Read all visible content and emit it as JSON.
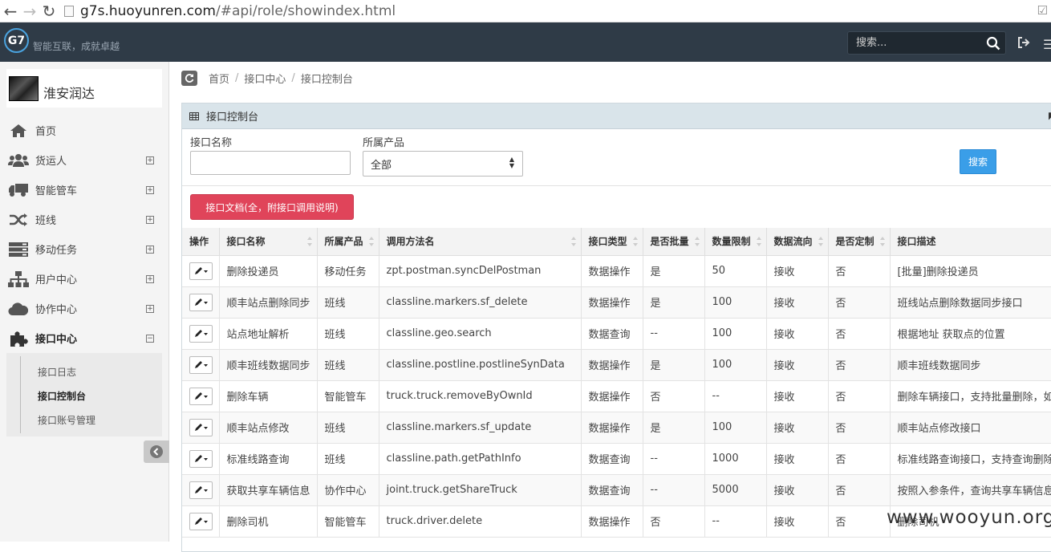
{
  "browser": {
    "url_host": "g7s.huoyunren.com",
    "url_path": "/#api/role/showindex.html"
  },
  "header": {
    "logo_text": "G7",
    "slogan": "智能互联，成就卓越",
    "search_placeholder": "搜索..."
  },
  "sidebar": {
    "org_name": "淮安润达",
    "items": [
      {
        "label": "首页",
        "icon": "home-icon",
        "toggle": ""
      },
      {
        "label": "货运人",
        "icon": "users-icon",
        "toggle": "+"
      },
      {
        "label": "智能管车",
        "icon": "truck-icon",
        "toggle": "+"
      },
      {
        "label": "班线",
        "icon": "random-icon",
        "toggle": "+"
      },
      {
        "label": "移动任务",
        "icon": "server-icon",
        "toggle": "+"
      },
      {
        "label": "用户中心",
        "icon": "sitemap-icon",
        "toggle": "+"
      },
      {
        "label": "协作中心",
        "icon": "cloud-icon",
        "toggle": "+"
      },
      {
        "label": "接口中心",
        "icon": "puzzle-icon",
        "toggle": "−"
      }
    ],
    "submenu": [
      {
        "label": "接口日志"
      },
      {
        "label": "接口控制台"
      },
      {
        "label": "接口账号管理"
      }
    ]
  },
  "breadcrumb": {
    "home": "首页",
    "level1": "接口中心",
    "current": "接口控制台",
    "sep": "/"
  },
  "panel": {
    "title": "接口控制台"
  },
  "filters": {
    "name_label": "接口名称",
    "product_label": "所属产品",
    "product_value": "全部",
    "search_label": "搜索",
    "doc_button": "接口文档(全，附接口调用说明)"
  },
  "table": {
    "headers": [
      "操作",
      "接口名称",
      "所属产品",
      "调用方法名",
      "接口类型",
      "是否批量",
      "数量限制",
      "数据流向",
      "是否定制",
      "接口描述"
    ],
    "rows": [
      [
        "删除投递员",
        "移动任务",
        "zpt.postman.syncDelPostman",
        "数据操作",
        "是",
        "50",
        "接收",
        "否",
        "[批量]删除投递员"
      ],
      [
        "顺丰站点删除同步",
        "班线",
        "classline.markers.sf_delete",
        "数据操作",
        "是",
        "100",
        "接收",
        "否",
        "班线站点删除数据同步接口"
      ],
      [
        "站点地址解析",
        "班线",
        "classline.geo.search",
        "数据查询",
        "--",
        "100",
        "接收",
        "否",
        "根据地址 获取点的位置"
      ],
      [
        "顺丰班线数据同步",
        "班线",
        "classline.postline.postlineSynData",
        "数据操作",
        "是",
        "100",
        "接收",
        "否",
        "顺丰班线数据同步"
      ],
      [
        "删除车辆",
        "智能管车",
        "truck.truck.removeByOwnId",
        "数据操作",
        "否",
        "--",
        "接收",
        "否",
        "删除车辆接口，支持批量删除，如"
      ],
      [
        "顺丰站点修改",
        "班线",
        "classline.markers.sf_update",
        "数据操作",
        "是",
        "100",
        "接收",
        "否",
        "顺丰站点修改接口"
      ],
      [
        "标准线路查询",
        "班线",
        "classline.path.getPathInfo",
        "数据查询",
        "--",
        "1000",
        "接收",
        "否",
        "标准线路查询接口，支持查询删除"
      ],
      [
        "获取共享车辆信息",
        "协作中心",
        "joint.truck.getShareTruck",
        "数据查询",
        "--",
        "5000",
        "接收",
        "否",
        "按照入参条件，查询共享车辆信息"
      ],
      [
        "删除司机",
        "智能管车",
        "truck.driver.delete",
        "数据操作",
        "否",
        "--",
        "接收",
        "否",
        "删除司机"
      ]
    ]
  },
  "watermark": "www.wooyun.org",
  "colors": {
    "topbar": "#2f3b47",
    "primary": "#3a9ee8",
    "danger": "#e0445a",
    "panel_head": "#d9e4ea"
  }
}
